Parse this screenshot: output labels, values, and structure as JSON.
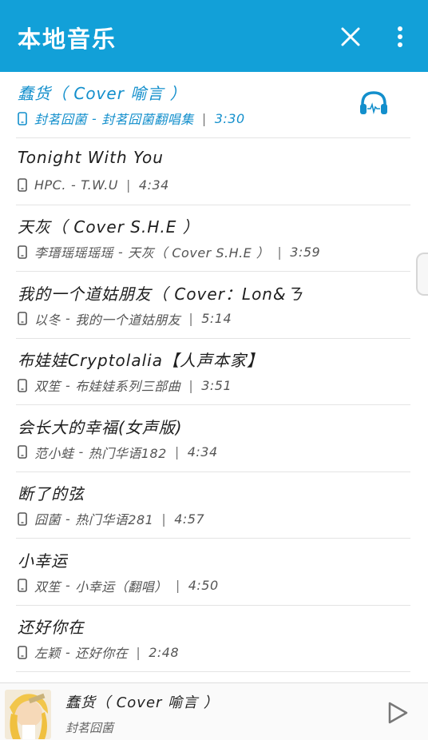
{
  "appbar": {
    "title": "本地音乐",
    "close_icon": "close-icon",
    "more_icon": "more-vertical-icon",
    "color": "#12a0d8"
  },
  "songs": [
    {
      "title": "蠢货（ Cover 喻言 ）",
      "artist": "封茗囧菌",
      "album": "封茗囧菌翻唱集",
      "duration": "3:30",
      "playing": true
    },
    {
      "title": "Tonight With You",
      "artist": "HPC.",
      "album": "T.W.U",
      "duration": "4:34"
    },
    {
      "title": "天灰（ Cover S.H.E ）",
      "artist": "李瑨瑶瑶瑶瑶",
      "album": "天灰（ Cover S.H.E ）",
      "duration": "3:59"
    },
    {
      "title": "我的一个道姑朋友（ Cover：Lon&ㄋ",
      "artist": "以冬",
      "album": "我的一个道姑朋友",
      "duration": "5:14"
    },
    {
      "title": "布娃娃Cryptolalia【人声本家】",
      "artist": "双笙",
      "album": "布娃娃系列三部曲",
      "duration": "3:51"
    },
    {
      "title": "会长大的幸福(女声版)",
      "artist": "范小蛙",
      "album": "热门华语182",
      "duration": "4:34"
    },
    {
      "title": "断了的弦",
      "artist": "囧菌",
      "album": "热门华语281",
      "duration": "4:57"
    },
    {
      "title": "小幸运",
      "artist": "双笙",
      "album": "小幸运（翻唱）",
      "duration": "4:50"
    },
    {
      "title": "还好你在",
      "artist": "左颖",
      "album": "还好你在",
      "duration": "2:48"
    }
  ],
  "meta_separator": "|",
  "meta_dash": "-",
  "now_playing": {
    "title": "蠢货（ Cover 喻言 ）",
    "artist": "封茗囧菌",
    "play_icon": "play-icon"
  },
  "accent_color": "#138fcc"
}
